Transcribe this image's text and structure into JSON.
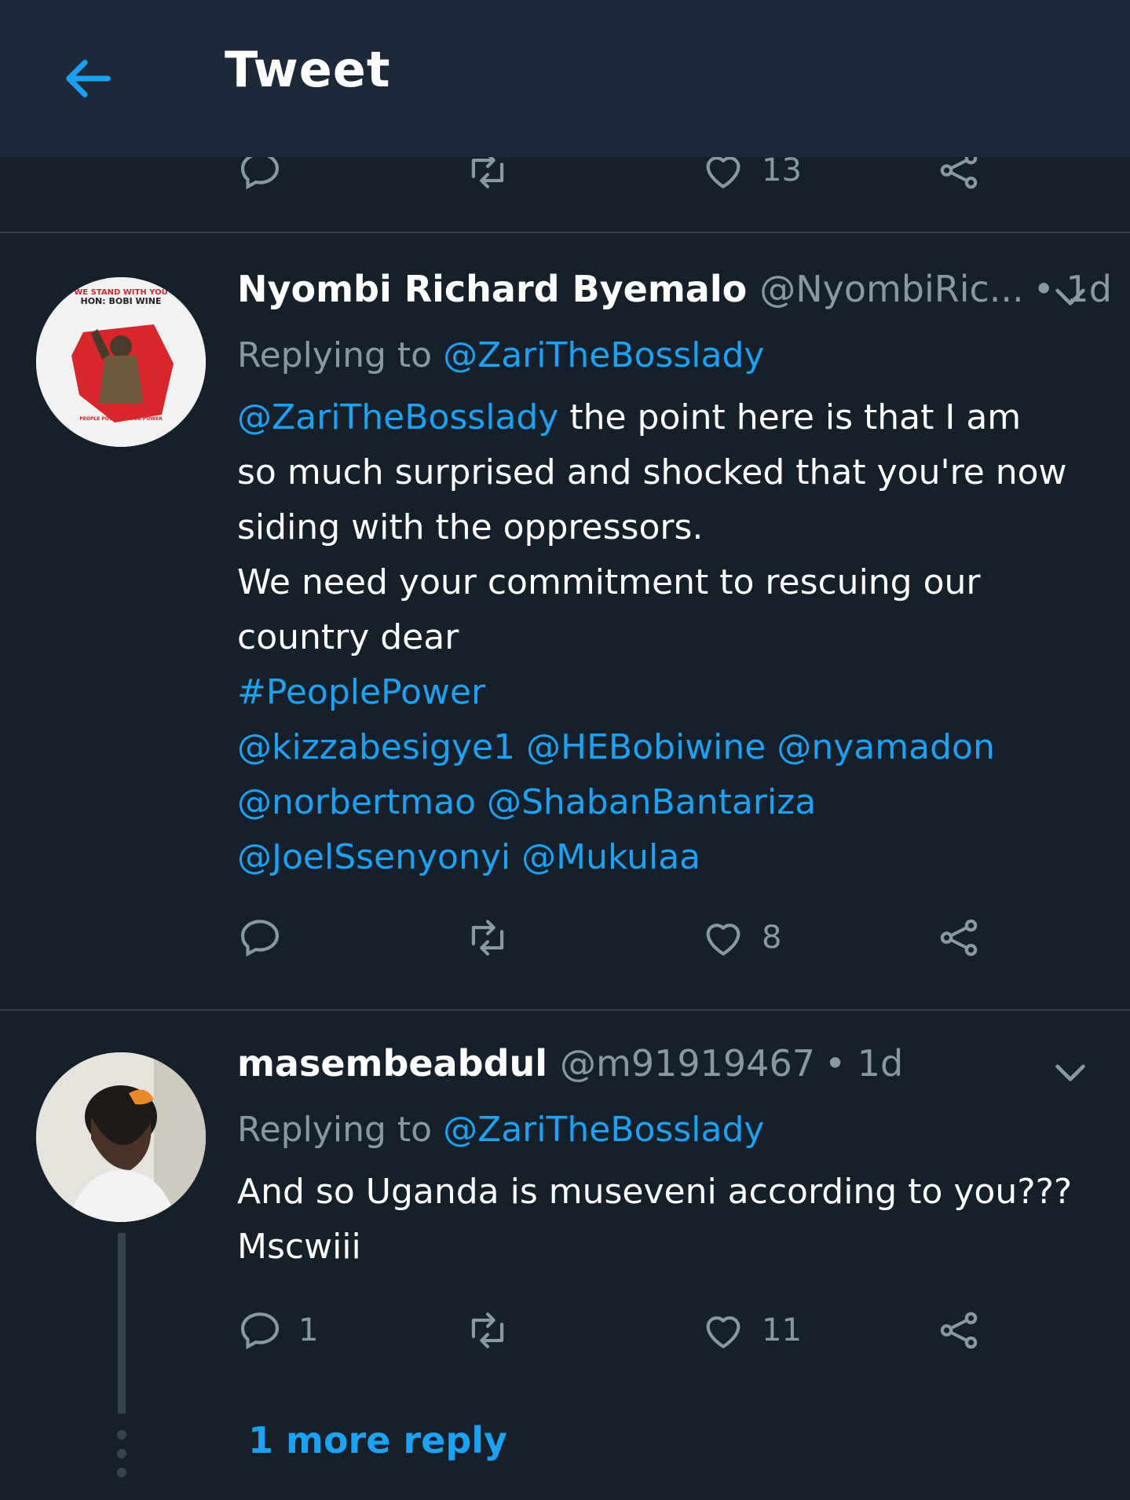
{
  "header": {
    "title": "Tweet"
  },
  "top_actions": {
    "like_count": "13"
  },
  "tweets": [
    {
      "name": "Nyombi Richard Byemalo",
      "handle": "@NyombiRic...",
      "time": "• 1d",
      "avatar_text_top": "WE STAND WITH YOU",
      "avatar_text_mid": "HON: BOBI WINE",
      "avatar_text_bottom": "PEOPLE POWER ... OUR POWER",
      "replying_label": "Replying to",
      "replying_to": "@ZariTheBosslady",
      "mention_lead": "@ZariTheBosslady",
      "text_line1": " the point here is that I am",
      "text_line2": "so much surprised and shocked that you're now",
      "text_line3": "siding with the oppressors.",
      "text_line4": "We need your commitment to rescuing our",
      "text_line5": "country dear",
      "hashtag": "#PeoplePower",
      "mentions_line1": [
        "@kizzabesigye1",
        "@HEBobiwine",
        "@nyamadon"
      ],
      "mentions_line2": [
        "@norbertmao",
        "@ShabanBantariza"
      ],
      "mentions_line3": [
        "@JoelSsenyonyi",
        "@Mukulaa"
      ],
      "reply_count": "",
      "like_count": "8"
    },
    {
      "name": "masembeabdul",
      "handle": "@m91919467",
      "time": "• 1d",
      "replying_label": "Replying to",
      "replying_to": "@ZariTheBosslady",
      "text_line1": "And so Uganda is museveni according to you???",
      "text_line2": "Mscwiii",
      "reply_count": "1",
      "like_count": "11"
    }
  ],
  "more_replies": "1 more reply",
  "colors": {
    "background": "#15202b",
    "header": "#1c2938",
    "accent": "#1da1f2",
    "muted": "#8899a6",
    "divider": "#38444d"
  }
}
